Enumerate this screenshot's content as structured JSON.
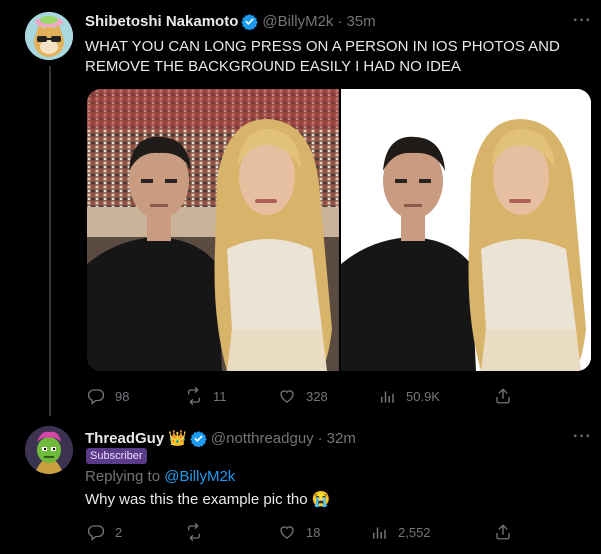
{
  "tweet": {
    "display_name": "Shibetoshi Nakamoto",
    "handle": "@BillyM2k",
    "separator": "·",
    "time": "35m",
    "more": "···",
    "text_line1": "WHAT YOU CAN LONG PRESS ON A PERSON IN IOS PHOTOS AND",
    "text_line2": "REMOVE THE BACKGROUND EASILY I HAD NO IDEA",
    "images": [
      "photo-with-background",
      "photo-background-removed"
    ],
    "actions": {
      "replies": "98",
      "retweets": "11",
      "likes": "328",
      "views": "50.9K"
    }
  },
  "reply": {
    "display_name": "ThreadGuy",
    "badge_emoji": "👑",
    "handle": "@notthreadguy",
    "separator": "·",
    "time": "32m",
    "more": "···",
    "subscriber_label": "Subscriber",
    "replying_prefix": "Replying to",
    "replying_handle": "@BillyM2k",
    "text": "Why was this the example pic tho 😭",
    "actions": {
      "replies": "2",
      "retweets": "",
      "likes": "18",
      "views": "2,552"
    }
  },
  "colors": {
    "background": "#000000",
    "text_primary": "#e7e9ea",
    "text_secondary": "#71767b",
    "accent": "#1d9bf0",
    "thread_line": "#333639",
    "subscriber_badge": "#5b3a88"
  },
  "icons": [
    "reply-icon",
    "retweet-icon",
    "like-icon",
    "views-icon",
    "share-icon",
    "verified-badge-icon",
    "more-icon"
  ]
}
